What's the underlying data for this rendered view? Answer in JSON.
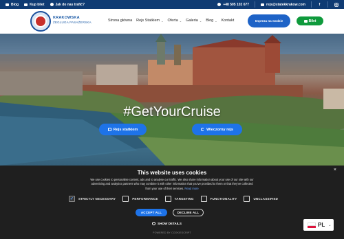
{
  "topbar": {
    "links": [
      {
        "label": "Blog",
        "icon": "book-icon"
      },
      {
        "label": "Kup bilet",
        "icon": "ticket-icon"
      },
      {
        "label": "Jak do nas trafić?",
        "icon": "map-pin-icon"
      }
    ],
    "phone": "+48 505 102 677",
    "email": "rejs@statekkrakow.com",
    "social": [
      "facebook-icon",
      "instagram-icon"
    ]
  },
  "brand": {
    "line1": "KRAKOWSKA",
    "line2": "ŻEGLUGA PASAŻERSKA"
  },
  "nav": {
    "items": [
      {
        "label": "Strona główna",
        "has_dropdown": false
      },
      {
        "label": "Rejs Statkiem",
        "has_dropdown": true
      },
      {
        "label": "Oferta",
        "has_dropdown": true
      },
      {
        "label": "Galeria",
        "has_dropdown": true
      },
      {
        "label": "Blog",
        "has_dropdown": true
      },
      {
        "label": "Kontakt",
        "has_dropdown": false
      }
    ]
  },
  "header_buttons": {
    "impreza": "Impreza na wodzie",
    "bilet": "Bilet"
  },
  "hero": {
    "title": "#GetYourCruise",
    "button_cruise": "Rejs statkiem",
    "button_evening": "Wieczorny rejs"
  },
  "cookie": {
    "title": "This website uses cookies",
    "text": "We use cookies to personalise content, ads and to analyse our traffic. We also share information about your use of our site with our advertising and analytics partners who may combine it with other information that you've provided to them or that they've collected from your use of their services.",
    "read_more": "Read more",
    "categories": [
      {
        "label": "STRICTLY NECESSARY",
        "checked": true
      },
      {
        "label": "PERFORMANCE",
        "checked": false
      },
      {
        "label": "TARGETING",
        "checked": false
      },
      {
        "label": "FUNCTIONALITY",
        "checked": false
      },
      {
        "label": "UNCLASSIFIED",
        "checked": false
      }
    ],
    "accept_label": "ACCEPT ALL",
    "decline_label": "DECLINE ALL",
    "show_details": "SHOW DETAILS",
    "powered_by": "POWERED BY COOKIESCRIPT",
    "close_symbol": "×"
  },
  "language": {
    "code": "PL"
  },
  "colors": {
    "topbar": "#0f3b73",
    "primary_blue": "#1e73e8",
    "green": "#0f9a3c",
    "cookie_bg": "#1f1f1f"
  }
}
